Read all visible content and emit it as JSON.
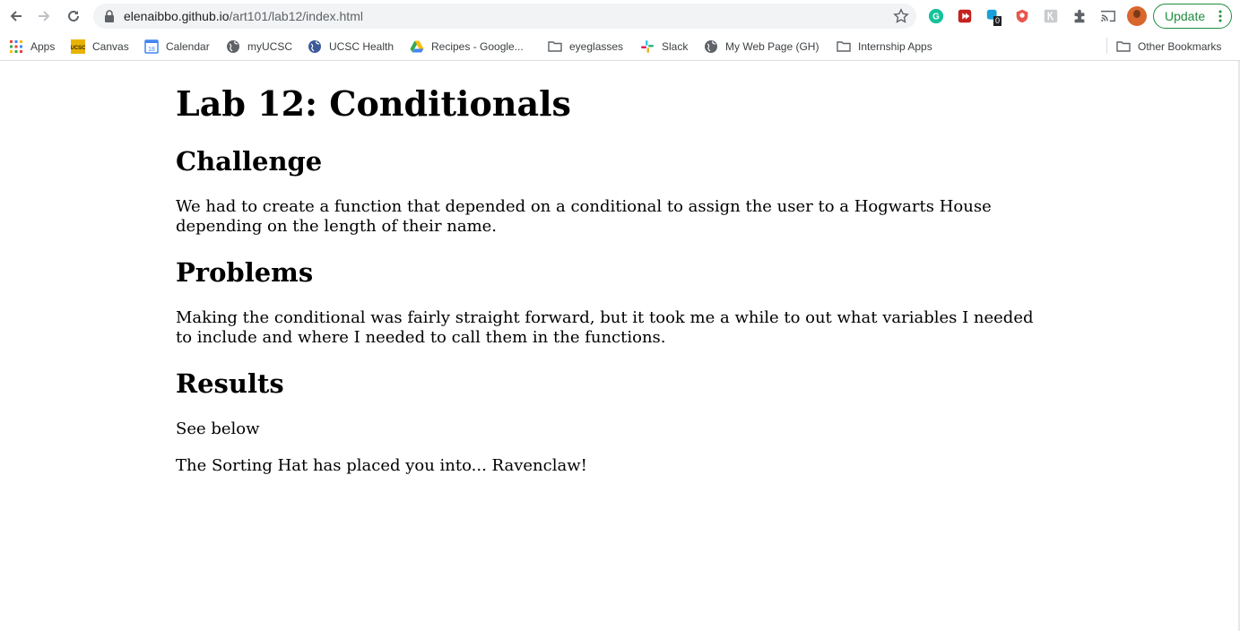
{
  "browser": {
    "url_host": "elenaibbo.github.io",
    "url_path": "/art101/lab12/index.html",
    "update_label": "Update"
  },
  "bookmarks": [
    {
      "label": "Apps",
      "icon": "apps-grid-icon"
    },
    {
      "label": "Canvas",
      "icon": "canvas-icon"
    },
    {
      "label": "Calendar",
      "icon": "calendar-icon"
    },
    {
      "label": "myUCSC",
      "icon": "globe-icon"
    },
    {
      "label": "UCSC Health",
      "icon": "globe-icon"
    },
    {
      "label": "Recipes - Google...",
      "icon": "google-drive-icon"
    },
    {
      "label": "eyeglasses",
      "icon": "folder-icon"
    },
    {
      "label": "Slack",
      "icon": "slack-icon"
    },
    {
      "label": "My Web Page (GH)",
      "icon": "globe-icon"
    },
    {
      "label": "Internship Apps",
      "icon": "folder-icon"
    }
  ],
  "other_bookmarks": "Other Bookmarks",
  "extensions": {
    "badge_count": "0"
  },
  "page": {
    "title": "Lab 12: Conditionals",
    "challenge_heading": "Challenge",
    "challenge_text": "We had to create a function that depended on a conditional to assign the user to a Hogwarts House depending on the length of their name.",
    "problems_heading": "Problems",
    "problems_text": "Making the conditional was fairly straight forward, but it took me a while to out what variables I needed to include and where I needed to call them in the functions.",
    "results_heading": "Results",
    "results_text": "See below",
    "output_text": "The Sorting Hat has placed you into... Ravenclaw!"
  },
  "colors": {
    "update_green": "#1e8e3e",
    "omnibox_bg": "#f1f3f4"
  }
}
